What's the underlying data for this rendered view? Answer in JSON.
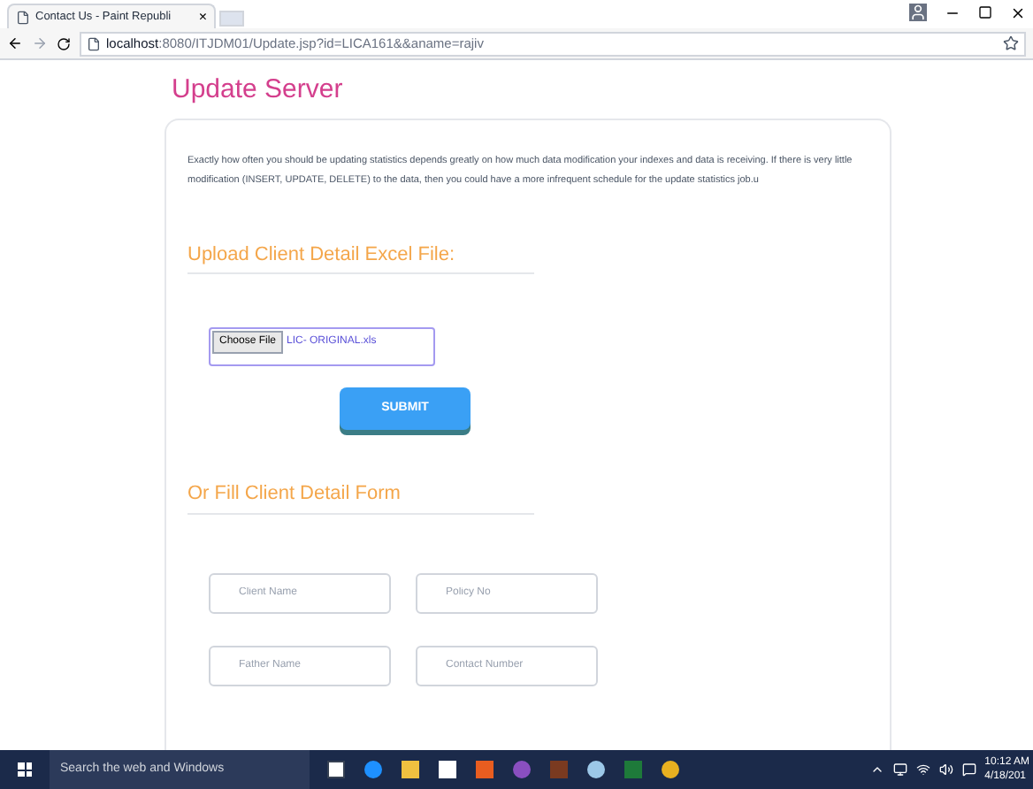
{
  "browser": {
    "tab_title": "Contact Us - Paint Republi",
    "tab_close": "×",
    "url_host": "localhost",
    "url_path": ":8080/ITJDM01/Update.jsp?id=LICA161&&aname=rajiv"
  },
  "page": {
    "title": "Update Server",
    "description": "Exactly how often you should be updating statistics depends greatly on how much data modification your indexes and data is receiving. If there is very little modification (INSERT, UPDATE, DELETE) to the data, then you could have a more infrequent schedule for the update statistics job.u",
    "upload_heading": "Upload Client Detail Excel File:",
    "file_input": {
      "button": "Choose File",
      "file_name": "LIC- ORIGINAL.xls"
    },
    "submit": "SUBMIT",
    "form_heading": "Or Fill Client Detail Form",
    "fields": [
      {
        "placeholder": "Client Name"
      },
      {
        "placeholder": "Policy No"
      },
      {
        "placeholder": "Father Name"
      },
      {
        "placeholder": "Contact Number"
      }
    ]
  },
  "taskbar": {
    "search_placeholder": "Search the web and Windows",
    "time": "10:12 AM",
    "date": "4/18/201"
  }
}
